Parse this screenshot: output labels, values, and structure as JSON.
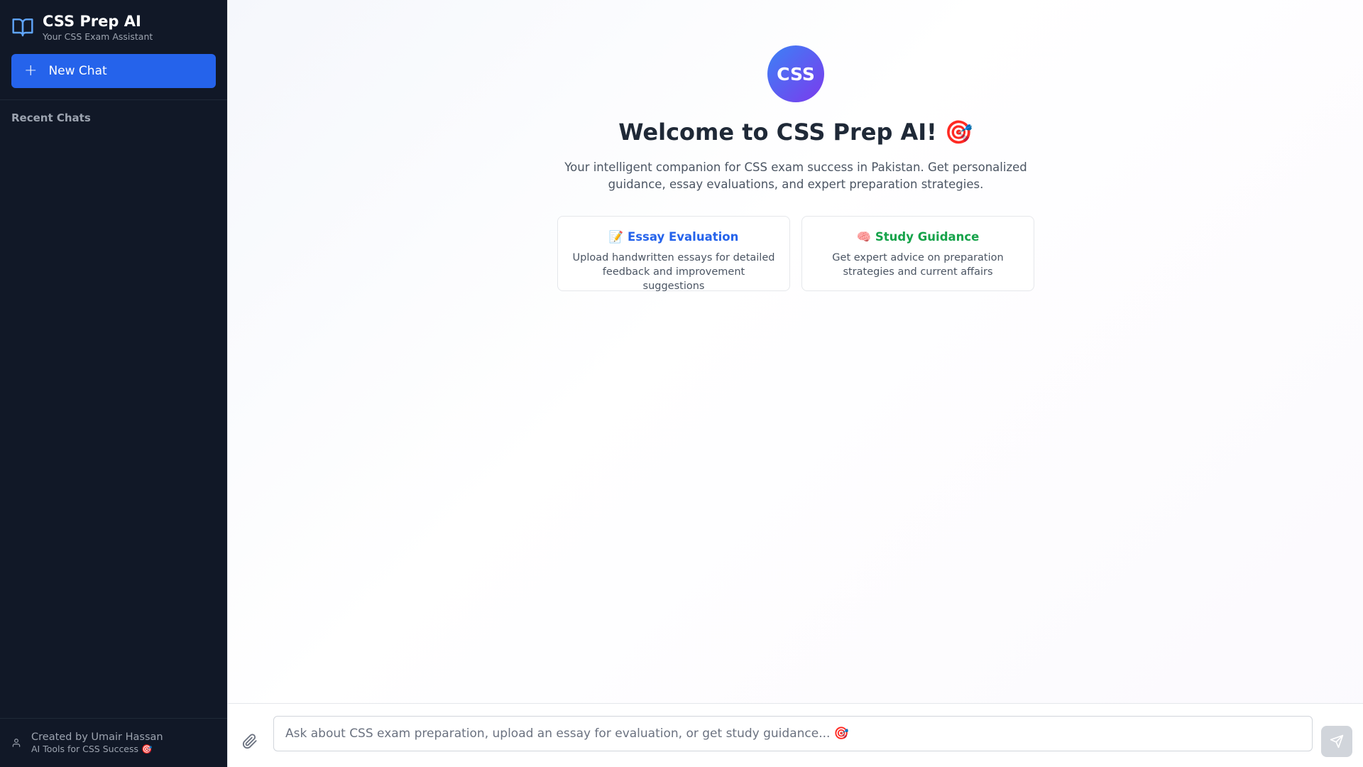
{
  "sidebar": {
    "brand_title": "CSS Prep AI",
    "brand_subtitle": "Your CSS Exam Assistant",
    "brand_icon": "book-open-icon",
    "new_chat_icon": "plus-icon",
    "new_chat_symbol": "+",
    "new_chat_label": "New Chat",
    "recent_label": "Recent Chats",
    "footer_icon": "user-icon",
    "footer_name": "Created by Umair Hassan",
    "footer_subtitle": "AI Tools for CSS Success 🎯"
  },
  "main": {
    "logo_text": "CSS",
    "welcome_title": "Welcome to CSS Prep AI! 🎯",
    "tagline": "Your intelligent companion for CSS exam success in Pakistan. Get personalized guidance, essay evaluations, and expert preparation strategies.",
    "cards": [
      {
        "title": "📝 Essay Evaluation",
        "description": "Upload handwritten essays for detailed feedback and improvement suggestions"
      },
      {
        "title": "🧠 Study Guidance",
        "description": "Get expert advice on preparation strategies and current affairs"
      }
    ]
  },
  "input": {
    "attach_icon": "paperclip-icon",
    "placeholder": "Ask about CSS exam preparation, upload an essay for evaluation, or get study guidance... 🎯",
    "value": "",
    "send_icon": "send-icon"
  },
  "colors": {
    "sidebar_bg": "#111827",
    "accent": "#2563eb",
    "logo_gradient_start": "#3b82f6",
    "logo_gradient_end": "#7c3aed",
    "essay_title": "#2563eb",
    "guidance_title": "#16a34a"
  }
}
